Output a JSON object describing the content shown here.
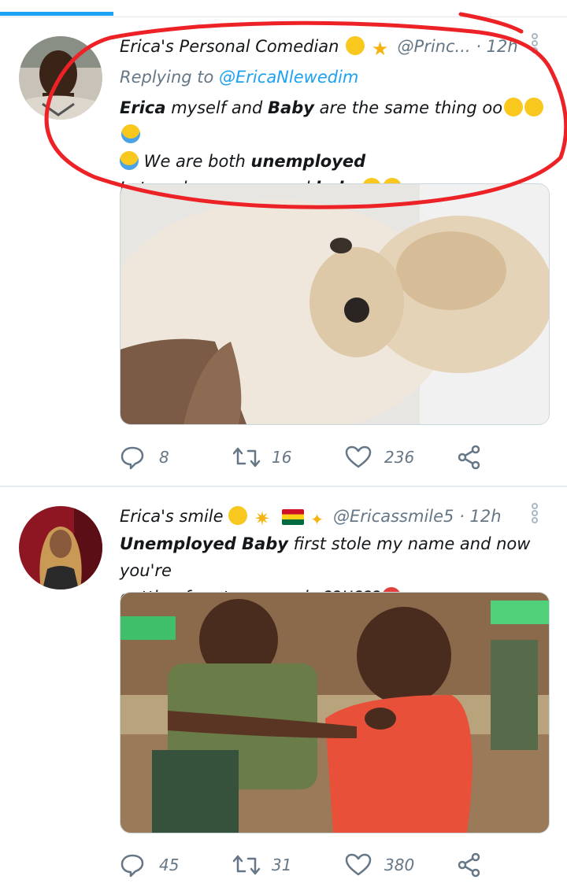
{
  "colors": {
    "accent": "#1da1f2",
    "muted": "#657786",
    "annotation": "#ec2227"
  },
  "tweets": [
    {
      "display_name": "Erica's Personal Comedian",
      "emojis": [
        "heart-eyes-emoji",
        "star-emoji"
      ],
      "handle": "@Princ...",
      "separator": "·",
      "time": "12h",
      "replying_label": "Replying to",
      "replying_to": "@EricaNlewedim",
      "text_line1_a": "Erica",
      "text_line1_b": " myself and ",
      "text_line1_c": "Baby",
      "text_line1_d": " are the same thing oo",
      "text_line2_a": " We are both ",
      "text_line2_b": "unemployed",
      "text_line3_a": "Let me be your second ",
      "text_line3_b": "baby",
      "media_description": "puppy-photo",
      "reply_count": "8",
      "retweet_count": "16",
      "like_count": "236"
    },
    {
      "display_name": "Erica's smile",
      "emojis": [
        "heart-eyes-emoji",
        "glowing-star-emoji",
        "ghana-flag-emoji",
        "sparkles-emoji"
      ],
      "handle": "@Ericassmile5",
      "separator": "·",
      "time": "12h",
      "text_line1_a": "Unemployed Baby",
      "text_line1_b": " first stole my name and now you're",
      "text_line2_a": "getting free tummy rubs??!!???",
      "media_description": "kids-fighting-photo",
      "reply_count": "45",
      "retweet_count": "31",
      "like_count": "380"
    }
  ]
}
